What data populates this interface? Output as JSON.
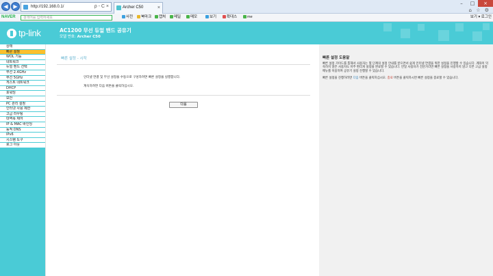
{
  "browser": {
    "address": "http://192.168.0.1/",
    "tab_title": "Archer C50",
    "tab_close": "×",
    "back_glyph": "◀",
    "forward_glyph": "▶",
    "addr_tools": "ρ - C ×",
    "window_controls": {
      "minimize": "–",
      "maximize": "□",
      "close": "×"
    },
    "right_icons": "⌂ ☆ ⚙"
  },
  "naver_bar": {
    "logo": "NAVER",
    "search_placeholder": "검색어를 입력하세요",
    "items": [
      {
        "label": "사전",
        "color": "#3aa0e0"
      },
      {
        "label": "북마크",
        "color": "#e8b82a"
      },
      {
        "label": "캡쳐",
        "color": "#49b54a"
      },
      {
        "label": "메일",
        "color": "#49b54a"
      },
      {
        "label": "메모",
        "color": "#49b54a"
      }
    ],
    "zoom": "보기",
    "print": "확대스",
    "me": "me",
    "right_tools": "보기 ▾   로그인"
  },
  "router": {
    "logo_text": "tp-link",
    "product_title": "AC1200 무선 듀얼 밴드 공유기",
    "model_prefix": "모델 번호:",
    "model_name": "Archer C50"
  },
  "sidebar": {
    "items": [
      {
        "label": "상태",
        "active": false
      },
      {
        "label": "빠른 설정",
        "active": true
      },
      {
        "label": "WOL 기능",
        "active": false
      },
      {
        "label": "네트워크",
        "active": false
      },
      {
        "label": "듀얼 밴드 선택",
        "active": false
      },
      {
        "label": "무선 2.4GHz",
        "active": false
      },
      {
        "label": "무선 5GHz",
        "active": false
      },
      {
        "label": "게스트 네트워크",
        "active": false
      },
      {
        "label": "DHCP",
        "active": false
      },
      {
        "label": "포워딩",
        "active": false
      },
      {
        "label": "보안",
        "active": false
      },
      {
        "label": "PC 관리 설정",
        "active": false
      },
      {
        "label": "인터넷 사용 제한",
        "active": false
      },
      {
        "label": "고급 라우팅",
        "active": false
      },
      {
        "label": "대역폭 제어",
        "active": false
      },
      {
        "label": "IP & MAC 바인딩",
        "active": false
      },
      {
        "label": "동적 DNS",
        "active": false
      },
      {
        "label": "IPv6",
        "active": false
      },
      {
        "label": "시스템 도구",
        "active": false
      },
      {
        "label": "로그 아웃",
        "active": false
      }
    ]
  },
  "content": {
    "section_title": "빠른 설정 - 시작",
    "line1": "인터넷 연결 및 무선 설정을 수동으로 구성하려면 빠른 설정을 실행합니다.",
    "line2": "계속하려면 다음 버튼을 클릭하십시오.",
    "next_label": "다음"
  },
  "help": {
    "title": "빠른 설정 도움말",
    "body": "빠른 설정 가이드를 통해서 사용자는 몇 단계의 설정 안내를 받으면서 쉽게 인터넷 연결을 위한 설정을 진행할 수 있습니다. 계좌이 익숙하지 않은 사용자도 아주 편리게 설정을 완료할 수 있습니다. 만일 사용자가 전문가라면 빠른 설정을 사용하지 않고 다른 고급 설정 메뉴를 이용하여 공유기 설정 진행할 수 있습니다.",
    "body2_prefix": "빠른 설정을 진행하려면",
    "body2_next": "다음",
    "body2_mid": "버튼을 클릭하십시오.",
    "body2_exit": "종료",
    "body2_suffix": "버튼을 클릭하시면 빠른 설정을 종료할 수 있습니다."
  }
}
